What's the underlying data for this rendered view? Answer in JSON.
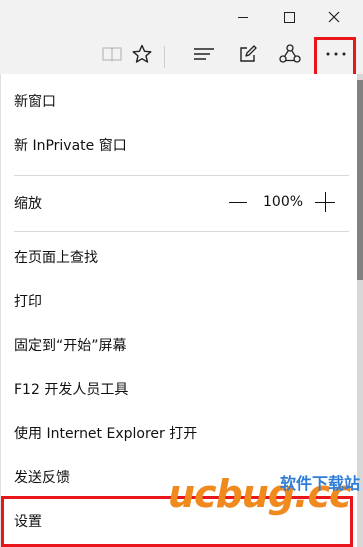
{
  "menu": {
    "new_window": "新窗口",
    "new_inprivate": "新 InPrivate 窗口",
    "zoom_label": "缩放",
    "zoom_value": "100%",
    "find_on_page": "在页面上查找",
    "print": "打印",
    "pin_to_start": "固定到“开始”屏幕",
    "f12_tools": "F12 开发人员工具",
    "open_with_ie": "使用 Internet Explorer 打开",
    "send_feedback": "发送反馈",
    "settings": "设置"
  },
  "watermark": {
    "brand_latin": "ucbug.cc",
    "brand_cn": "软件下载站"
  },
  "colors": {
    "highlight": "#e8161b",
    "watermark_orange": "#f08a1e",
    "watermark_blue": "#2e7ed8"
  }
}
